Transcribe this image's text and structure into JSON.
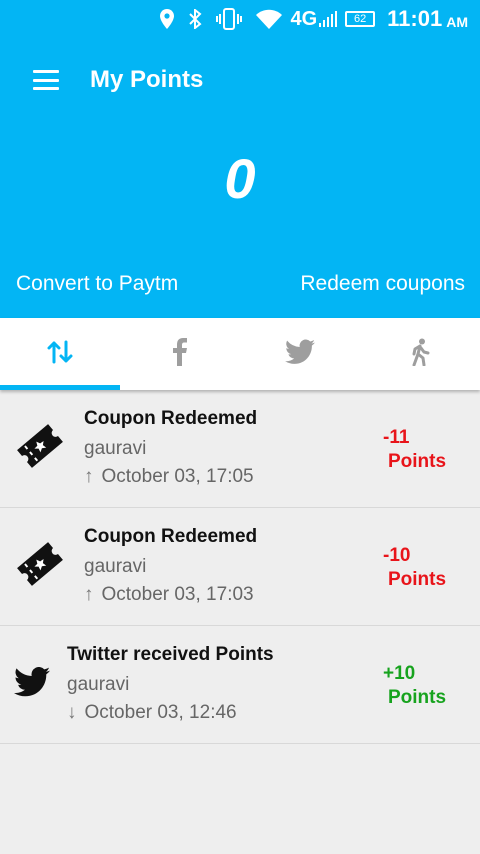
{
  "status_bar": {
    "network": "4G",
    "battery": "62",
    "time": "11:01",
    "ampm": "AM",
    "icons": [
      "location-icon",
      "bluetooth-icon",
      "vibrate-icon",
      "wifi-icon",
      "signal-icon",
      "battery-icon"
    ]
  },
  "app_bar": {
    "title": "My Points"
  },
  "points": {
    "value": "0"
  },
  "actions": {
    "convert_label": "Convert to Paytm",
    "redeem_label": "Redeem coupons"
  },
  "tabs": [
    {
      "icon": "transactions-icon",
      "active": true
    },
    {
      "icon": "facebook-icon",
      "active": false
    },
    {
      "icon": "twitter-icon",
      "active": false
    },
    {
      "icon": "walking-icon",
      "active": false
    }
  ],
  "transactions": [
    {
      "icon": "ticket-icon",
      "title": "Coupon Redeemed",
      "user": "gauravi",
      "direction": "↑",
      "date": "October 03, 17:05",
      "points": "-11",
      "unit": "Points",
      "sign": "neg"
    },
    {
      "icon": "ticket-icon",
      "title": "Coupon Redeemed",
      "user": "gauravi",
      "direction": "↑",
      "date": "October 03, 17:03",
      "points": "-10",
      "unit": "Points",
      "sign": "neg"
    },
    {
      "icon": "twitter-icon",
      "title": "Twitter received Points",
      "user": "gauravi",
      "direction": "↓",
      "date": "October 03, 12:46",
      "points": "+10",
      "unit": "Points",
      "sign": "pos"
    }
  ],
  "colors": {
    "primary": "#03b5f4",
    "negative": "#e8141a",
    "positive": "#17a31e",
    "inactive_icon": "#9e9e9e"
  }
}
